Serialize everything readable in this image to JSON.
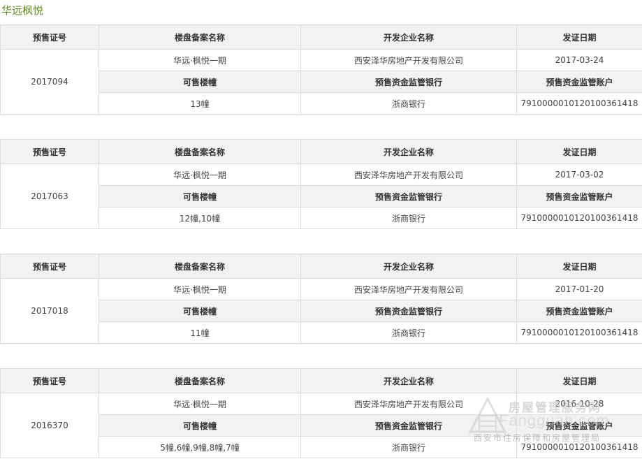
{
  "page_title": "华远枫悦",
  "headers": {
    "permit_no": "预售证号",
    "project_name": "楼盘备案名称",
    "developer": "开发企业名称",
    "issue_date": "发证日期",
    "buildings": "可售楼幢",
    "bank": "预售资金监管银行",
    "account": "预售资金监管账户"
  },
  "permits": [
    {
      "permit_no": "2017094",
      "project_name": "华远·枫悦一期",
      "developer": "西安泽华房地产开发有限公司",
      "issue_date": "2017-03-24",
      "buildings": "13幢",
      "bank": "浙商银行",
      "account": "791000001012010036141 8"
    },
    {
      "permit_no": "2017063",
      "project_name": "华远·枫悦一期",
      "developer": "西安泽华房地产开发有限公司",
      "issue_date": "2017-03-02",
      "buildings": "12幢,10幢",
      "bank": "浙商银行",
      "account": "7910000010120100361418"
    },
    {
      "permit_no": "2017018",
      "project_name": "华远·枫悦一期",
      "developer": "西安泽华房地产开发有限公司",
      "issue_date": "2017-01-20",
      "buildings": "11幢",
      "bank": "浙商银行",
      "account": "7910000010120100361418"
    },
    {
      "permit_no": "2016370",
      "project_name": "华远·枫悦一期",
      "developer": "西安泽华房地产开发有限公司",
      "issue_date": "2016-10-28",
      "buildings": "5幢,6幢,9幢,8幢,7幢",
      "bank": "浙商银行",
      "account": "7910000010120100361418"
    }
  ],
  "watermark": {
    "line1": "房屋管理服务网",
    "line2": "Fangguan.com",
    "line3": "西安市住房保障和房屋管理局"
  }
}
